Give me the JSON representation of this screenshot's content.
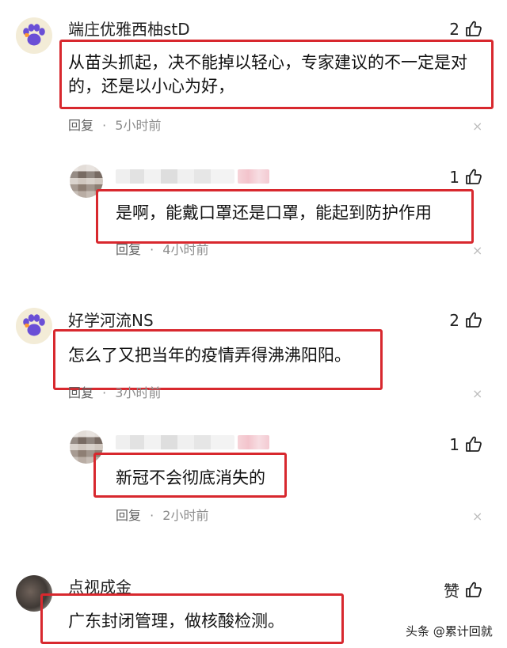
{
  "comments": [
    {
      "username": "端庄优雅西柚stD",
      "likes": "2",
      "text_line1": "从苗头抓起，决不能掉以轻心，专家建议的不一定是对",
      "text_line2": "的，还是以小心为好，",
      "reply_label": "回复",
      "dot": "·",
      "time": "5小时前",
      "close": "×"
    },
    {
      "likes": "1",
      "text": "是啊，能戴口罩还是口罩，能起到防护作用",
      "reply_label": "回复",
      "dot": "·",
      "time": "4小时前",
      "close": "×"
    },
    {
      "username": "好学河流NS",
      "likes": "2",
      "text": "怎么了又把当年的疫情弄得沸沸阳阳。",
      "reply_label": "回复",
      "dot": "·",
      "time": "3小时前",
      "close": "×"
    },
    {
      "likes": "1",
      "text": "新冠不会彻底消失的",
      "reply_label": "回复",
      "dot": "·",
      "time": "2小时前",
      "close": "×"
    },
    {
      "username": "点视成金",
      "likes": "赞",
      "text": "广东封闭管理，做核酸检测。"
    }
  ],
  "watermark": "头条 @累计回就",
  "colors": {
    "highlight_box": "#d8282e",
    "meta_text": "#8d8d8d"
  },
  "icons": [
    "thumbs-up-icon",
    "paw-icon",
    "close-icon"
  ]
}
